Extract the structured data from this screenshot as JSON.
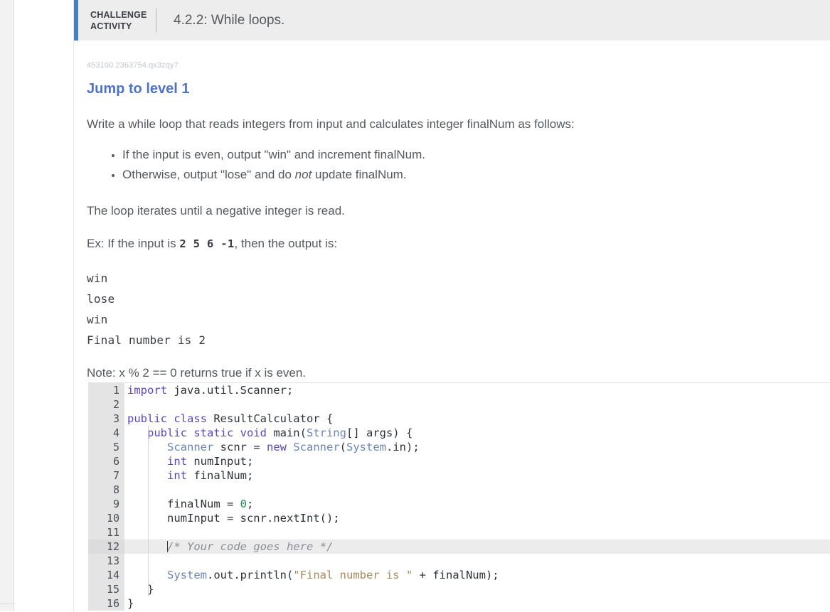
{
  "header": {
    "kicker": "CHALLENGE ACTIVITY",
    "title": "4.2.2: While loops."
  },
  "activity": {
    "id": "453100.2363754.qx3zqy7",
    "jump_link": "Jump to level 1",
    "prompt": "Write a while loop that reads integers from input and calculates integer finalNum as follows:",
    "bullets": [
      {
        "pre": "If the input is even, output \"win\" and increment finalNum.",
        "italic": "",
        "post": ""
      },
      {
        "pre": "Otherwise, output \"lose\" and do ",
        "italic": "not",
        "post": " update finalNum."
      }
    ],
    "loop_note": "The loop iterates until a negative integer is read.",
    "example": {
      "lead": "Ex: If the input is ",
      "input": "2 5 6 -1",
      "trail": ", then the output is:"
    },
    "output_lines": [
      "win",
      "lose",
      "win",
      "Final number is 2"
    ],
    "note": "Note: x % 2 == 0 returns true if x is even."
  },
  "editor": {
    "active_line": 12,
    "lines": [
      {
        "n": "1",
        "tokens": [
          {
            "t": "import ",
            "c": "kw"
          },
          {
            "t": "java.util.Scanner;",
            "c": "pun"
          }
        ]
      },
      {
        "n": "2",
        "tokens": []
      },
      {
        "n": "3",
        "tokens": [
          {
            "t": "public class ",
            "c": "kw"
          },
          {
            "t": "ResultCalculator {",
            "c": "pun"
          }
        ]
      },
      {
        "n": "4",
        "tokens": [
          {
            "t": "   ",
            "c": "pun"
          },
          {
            "t": "public static void ",
            "c": "kw"
          },
          {
            "t": "main(",
            "c": "pun"
          },
          {
            "t": "String",
            "c": "typ"
          },
          {
            "t": "[] args) {",
            "c": "pun"
          }
        ]
      },
      {
        "n": "5",
        "tokens": [
          {
            "t": "      ",
            "c": "pun"
          },
          {
            "t": "Scanner",
            "c": "typ"
          },
          {
            "t": " scnr ",
            "c": "pun"
          },
          {
            "t": "=",
            "c": "pun"
          },
          {
            "t": " new ",
            "c": "kw"
          },
          {
            "t": "Scanner",
            "c": "typ"
          },
          {
            "t": "(",
            "c": "pun"
          },
          {
            "t": "System",
            "c": "typ"
          },
          {
            "t": ".in);",
            "c": "pun"
          }
        ]
      },
      {
        "n": "6",
        "tokens": [
          {
            "t": "      ",
            "c": "pun"
          },
          {
            "t": "int",
            "c": "kw"
          },
          {
            "t": " numInput;",
            "c": "pun"
          }
        ]
      },
      {
        "n": "7",
        "tokens": [
          {
            "t": "      ",
            "c": "pun"
          },
          {
            "t": "int",
            "c": "kw"
          },
          {
            "t": " finalNum;",
            "c": "pun"
          }
        ]
      },
      {
        "n": "8",
        "tokens": []
      },
      {
        "n": "9",
        "tokens": [
          {
            "t": "      finalNum = ",
            "c": "pun"
          },
          {
            "t": "0",
            "c": "num"
          },
          {
            "t": ";",
            "c": "pun"
          }
        ]
      },
      {
        "n": "10",
        "tokens": [
          {
            "t": "      numInput = scnr.nextInt();",
            "c": "pun"
          }
        ]
      },
      {
        "n": "11",
        "tokens": []
      },
      {
        "n": "12",
        "tokens": [
          {
            "t": "      ",
            "c": "pun"
          },
          {
            "t": "/* Your code goes here */",
            "c": "cmt"
          }
        ]
      },
      {
        "n": "13",
        "tokens": []
      },
      {
        "n": "14",
        "tokens": [
          {
            "t": "      ",
            "c": "pun"
          },
          {
            "t": "System",
            "c": "typ"
          },
          {
            "t": ".out.println(",
            "c": "pun"
          },
          {
            "t": "\"Final number is \"",
            "c": "str"
          },
          {
            "t": " + finalNum);",
            "c": "pun"
          }
        ]
      },
      {
        "n": "15",
        "tokens": [
          {
            "t": "   }",
            "c": "pun"
          }
        ]
      },
      {
        "n": "16",
        "tokens": [
          {
            "t": "}",
            "c": "pun"
          }
        ]
      }
    ]
  },
  "colors": {
    "accent_blue": "#4a7ebb",
    "link_blue": "#5173c6",
    "header_bg": "#ededed",
    "gutter_bg": "#e4e4e4",
    "active_line_bg": "#ececec",
    "keyword": "#5b46c4",
    "type": "#6d85b5",
    "number": "#1f8a4c",
    "string": "#a8895c",
    "comment": "#8a8f94"
  }
}
